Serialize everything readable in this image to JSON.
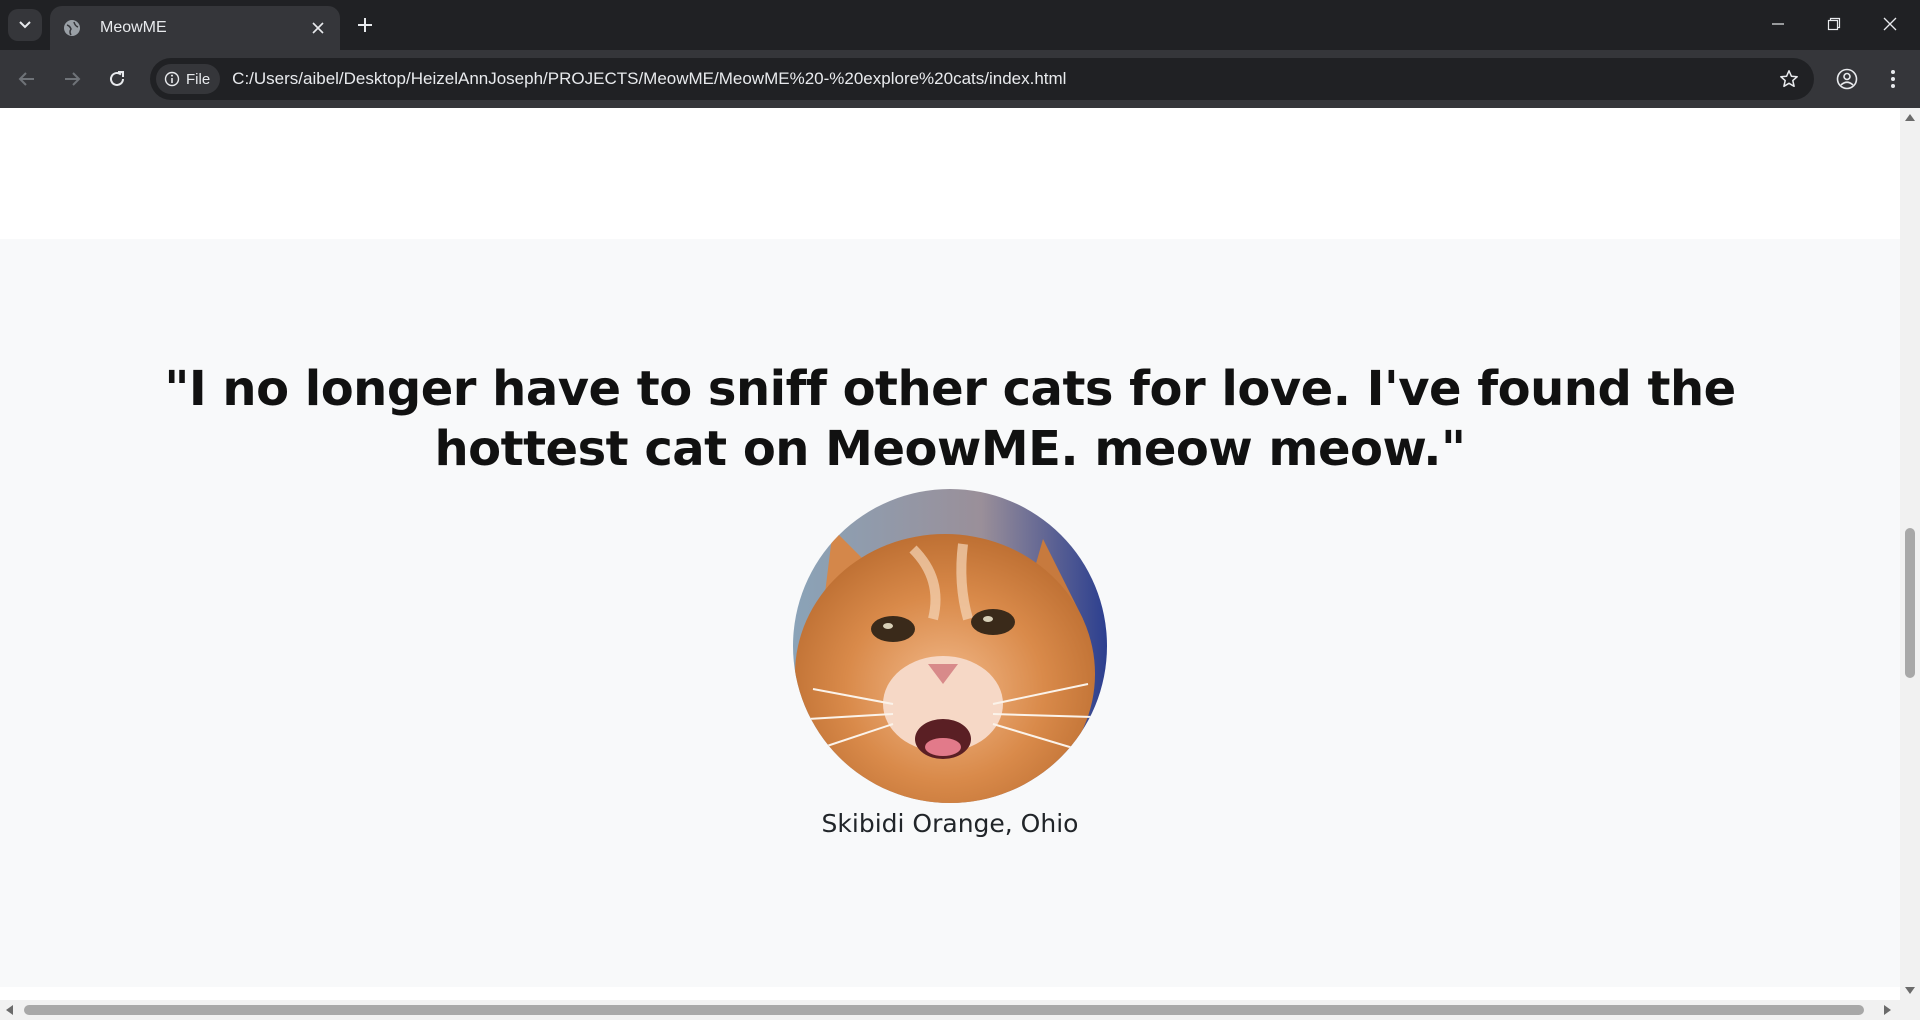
{
  "browser": {
    "tab_title": "MeowME",
    "site_chip_label": "File",
    "url": "C:/Users/aibel/Desktop/HeizelAnnJoseph/PROJECTS/MeowME/MeowME%20-%20explore%20cats/index.html"
  },
  "testimonial": {
    "quote": "\"I no longer have to sniff other cats for love. I've found the hottest cat on MeowME. meow meow.\"",
    "author": "Skibidi Orange, Ohio"
  },
  "colors": {
    "chrome_dark": "#202124",
    "chrome_toolbar": "#35363a",
    "section_bg": "#f8f9fa",
    "quote_text": "#111111"
  }
}
